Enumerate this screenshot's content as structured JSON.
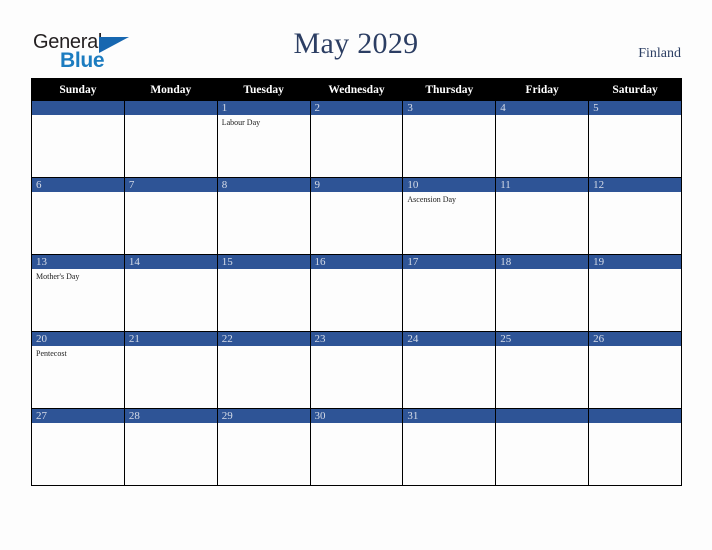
{
  "brand": {
    "word_one": "General",
    "word_two": "Blue",
    "triangle_color": "#1767b0",
    "blue_color": "#1c7cc0",
    "general_color": "#231f20"
  },
  "header": {
    "title": "May 2029",
    "country": "Finland",
    "title_color": "#2c3e63"
  },
  "theme": {
    "header_row_bg": "#000000",
    "header_row_text": "#ffffff",
    "date_strip_bg": "#2e5496",
    "date_strip_text": "#d6dce8",
    "cell_bg": "#fdfdfd",
    "page_bg": "#fdfdfd",
    "grid_line": "#000000"
  },
  "weekday_headers": [
    "Sunday",
    "Monday",
    "Tuesday",
    "Wednesday",
    "Thursday",
    "Friday",
    "Saturday"
  ],
  "weeks": [
    [
      {
        "date": "",
        "events": []
      },
      {
        "date": "",
        "events": []
      },
      {
        "date": "1",
        "events": [
          "Labour Day"
        ]
      },
      {
        "date": "2",
        "events": []
      },
      {
        "date": "3",
        "events": []
      },
      {
        "date": "4",
        "events": []
      },
      {
        "date": "5",
        "events": []
      }
    ],
    [
      {
        "date": "6",
        "events": []
      },
      {
        "date": "7",
        "events": []
      },
      {
        "date": "8",
        "events": []
      },
      {
        "date": "9",
        "events": []
      },
      {
        "date": "10",
        "events": [
          "Ascension Day"
        ]
      },
      {
        "date": "11",
        "events": []
      },
      {
        "date": "12",
        "events": []
      }
    ],
    [
      {
        "date": "13",
        "events": [
          "Mother's Day"
        ]
      },
      {
        "date": "14",
        "events": []
      },
      {
        "date": "15",
        "events": []
      },
      {
        "date": "16",
        "events": []
      },
      {
        "date": "17",
        "events": []
      },
      {
        "date": "18",
        "events": []
      },
      {
        "date": "19",
        "events": []
      }
    ],
    [
      {
        "date": "20",
        "events": [
          "Pentecost"
        ]
      },
      {
        "date": "21",
        "events": []
      },
      {
        "date": "22",
        "events": []
      },
      {
        "date": "23",
        "events": []
      },
      {
        "date": "24",
        "events": []
      },
      {
        "date": "25",
        "events": []
      },
      {
        "date": "26",
        "events": []
      }
    ],
    [
      {
        "date": "27",
        "events": []
      },
      {
        "date": "28",
        "events": []
      },
      {
        "date": "29",
        "events": []
      },
      {
        "date": "30",
        "events": []
      },
      {
        "date": "31",
        "events": []
      },
      {
        "date": "",
        "events": []
      },
      {
        "date": "",
        "events": []
      }
    ]
  ]
}
